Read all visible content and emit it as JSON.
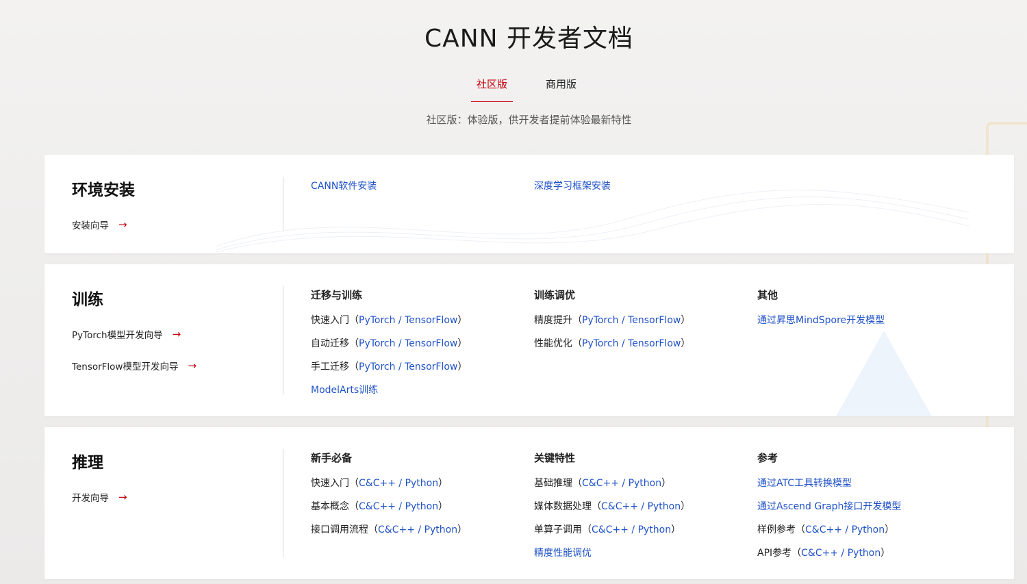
{
  "header": {
    "title": "CANN 开发者文档",
    "tabs": [
      {
        "label": "社区版",
        "active": true
      },
      {
        "label": "商用版",
        "active": false
      }
    ],
    "subtitle": "社区版：体验版，供开发者提前体验最新特性"
  },
  "colors": {
    "accent": "#c7000b",
    "link": "#1f52c7"
  },
  "sections": {
    "install": {
      "title": "环境安装",
      "guides": [
        "安装向导"
      ],
      "links": [
        "CANN软件安装",
        "深度学习框架安装"
      ]
    },
    "train": {
      "title": "训练",
      "guides": [
        "PyTorch模型开发向导",
        "TensorFlow模型开发向导"
      ],
      "col1": {
        "head": "迁移与训练",
        "rows": [
          {
            "prefix": "快速入门（",
            "l1": "PyTorch",
            "sep": " / ",
            "l2": "TensorFlow",
            "suffix": "）"
          },
          {
            "prefix": "自动迁移（",
            "l1": "PyTorch",
            "sep": " / ",
            "l2": "TensorFlow",
            "suffix": "）"
          },
          {
            "prefix": "手工迁移（",
            "l1": "PyTorch",
            "sep": " / ",
            "l2": "TensorFlow",
            "suffix": "）"
          }
        ],
        "link": "ModelArts训练"
      },
      "col2": {
        "head": "训练调优",
        "rows": [
          {
            "prefix": "精度提升（",
            "l1": "PyTorch",
            "sep": " / ",
            "l2": "TensorFlow",
            "suffix": "）"
          },
          {
            "prefix": "性能优化（",
            "l1": "PyTorch",
            "sep": " / ",
            "l2": "TensorFlow",
            "suffix": "）"
          }
        ]
      },
      "col3": {
        "head": "其他",
        "link": "通过昇思MindSpore开发模型"
      }
    },
    "infer": {
      "title": "推理",
      "guides": [
        "开发向导"
      ],
      "col1": {
        "head": "新手必备",
        "rows": [
          {
            "prefix": "快速入门（",
            "l1": "C&C++",
            "sep": " / ",
            "l2": "Python",
            "suffix": "）"
          },
          {
            "prefix": "基本概念（",
            "l1": "C&C++",
            "sep": " / ",
            "l2": "Python",
            "suffix": "）"
          },
          {
            "prefix": "接口调用流程（",
            "l1": "C&C++",
            "sep": " / ",
            "l2": "Python",
            "suffix": "）"
          }
        ]
      },
      "col2": {
        "head": "关键特性",
        "rows": [
          {
            "prefix": "基础推理（",
            "l1": "C&C++",
            "sep": " / ",
            "l2": "Python",
            "suffix": "）"
          },
          {
            "prefix": "媒体数据处理（",
            "l1": "C&C++",
            "sep": " / ",
            "l2": "Python",
            "suffix": "）"
          },
          {
            "prefix": "单算子调用（",
            "l1": "C&C++",
            "sep": " / ",
            "l2": "Python",
            "suffix": "）"
          }
        ],
        "link": "精度性能调优"
      },
      "col3": {
        "head": "参考",
        "links": [
          "通过ATC工具转换模型",
          "通过Ascend Graph接口开发模型"
        ],
        "rows": [
          {
            "prefix": "样例参考（",
            "l1": "C&C++",
            "sep": " / ",
            "l2": "Python",
            "suffix": "）"
          },
          {
            "prefix": "API参考（",
            "l1": "C&C++",
            "sep": " / ",
            "l2": "Python",
            "suffix": "）"
          }
        ]
      }
    }
  }
}
